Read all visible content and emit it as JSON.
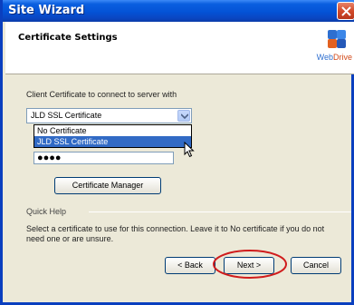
{
  "window": {
    "title": "Site Wizard"
  },
  "header": {
    "title": "Certificate Settings",
    "logo_web": "Web",
    "logo_drive": "Drive"
  },
  "certificate": {
    "label": "Client Certificate to connect to server with",
    "selected": "JLD SSL Certificate",
    "options": [
      "No Certificate",
      "JLD SSL Certificate"
    ],
    "highlighted_index": 1
  },
  "password": {
    "masked_value": "●●●●"
  },
  "buttons": {
    "certificate_manager": "Certificate Manager",
    "back": "< Back",
    "next": "Next >",
    "cancel": "Cancel"
  },
  "help": {
    "title": "Quick Help",
    "text": "Select a certificate to use for this connection.  Leave it to No certificate if you do not need one or are unsure."
  },
  "colors": {
    "titlebar": "#0453d6",
    "selection": "#316ac5",
    "annotation_circle": "#d01c1c"
  }
}
